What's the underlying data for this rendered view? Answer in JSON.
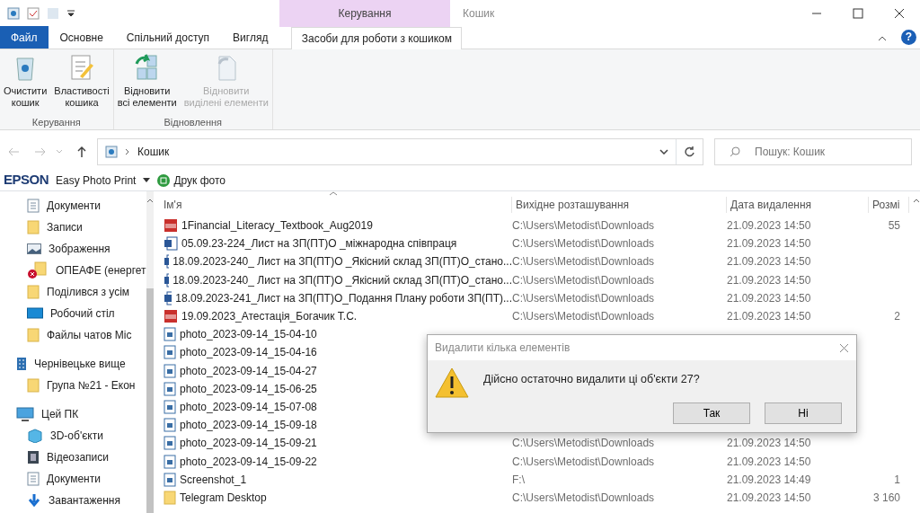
{
  "window": {
    "title": "Кошик",
    "context_group": "Керування",
    "help_glyph": "?"
  },
  "tabs": [
    {
      "label": "Файл",
      "kind": "file",
      "selected": false
    },
    {
      "label": "Основне",
      "kind": "tab",
      "selected": false
    },
    {
      "label": "Спільний доступ",
      "kind": "tab",
      "selected": false
    },
    {
      "label": "Вигляд",
      "kind": "tab",
      "selected": false
    },
    {
      "label": "Засоби для роботи з кошиком",
      "kind": "context",
      "selected": true
    }
  ],
  "ribbon_groups": [
    {
      "label": "Керування",
      "buttons": [
        {
          "label": "Очистити\nкошик",
          "disabled": false
        },
        {
          "label": "Властивості\nкошика",
          "disabled": false
        }
      ]
    },
    {
      "label": "Відновлення",
      "buttons": [
        {
          "label": "Відновити\nвсі елементи",
          "disabled": false
        },
        {
          "label": "Відновити\nвиділені елементи",
          "disabled": true
        }
      ]
    }
  ],
  "address": {
    "path": "Кошик",
    "search_placeholder": "Пошук: Кошик"
  },
  "epson_bar": {
    "brand": "EPSON",
    "app": "Easy Photo Print",
    "action": "Друк фото"
  },
  "sidebar": {
    "sections": [
      {
        "items": [
          {
            "label": "Документи",
            "kind": "doc"
          },
          {
            "label": "Записи",
            "kind": "folder"
          },
          {
            "label": "Зображення",
            "kind": "pictures"
          },
          {
            "label": "ОПЕАФЕ (енергет",
            "kind": "folder_error"
          },
          {
            "label": "Поділився з усім",
            "kind": "folder"
          },
          {
            "label": "Робочий стіл",
            "kind": "desktop"
          },
          {
            "label": "Файлы чатов Mic",
            "kind": "folder"
          }
        ]
      },
      {
        "title": "Чернівецьке вище",
        "kind": "building",
        "items": [
          {
            "label": "Група №21 - Екон",
            "kind": "folder"
          }
        ]
      },
      {
        "title": "Цей ПК",
        "kind": "pc",
        "items": [
          {
            "label": "3D-об'єкти",
            "kind": "cube"
          },
          {
            "label": "Відеозаписи",
            "kind": "video"
          },
          {
            "label": "Документи",
            "kind": "doc"
          },
          {
            "label": "Завантаження",
            "kind": "download"
          }
        ]
      }
    ]
  },
  "table": {
    "columns": [
      "Ім'я",
      "Вихідне розташування",
      "Дата видалення",
      "Розмі"
    ],
    "rows": [
      {
        "kind": "pdf",
        "name": "1Financial_Literacy_Textbook_Aug2019",
        "location": "C:\\Users\\Metodist\\Downloads",
        "date": "21.09.2023 14:50",
        "size": "55"
      },
      {
        "kind": "word",
        "name": "05.09.23-224_Лист на ЗП(ПТ)О _міжнародна співпраця",
        "location": "C:\\Users\\Metodist\\Downloads",
        "date": "21.09.2023 14:50"
      },
      {
        "kind": "word",
        "name": "18.09.2023-240_ Лист на ЗП(ПТ)О _Якісний склад ЗП(ПТ)О_стано...",
        "location": "C:\\Users\\Metodist\\Downloads",
        "date": "21.09.2023 14:50"
      },
      {
        "kind": "word",
        "name": "18.09.2023-240_ Лист на ЗП(ПТ)О _Якісний склад ЗП(ПТ)О_стано...",
        "location": "C:\\Users\\Metodist\\Downloads",
        "date": "21.09.2023 14:50"
      },
      {
        "kind": "word",
        "name": "18.09.2023-241_Лист на ЗП(ПТ)О_Подання Плану роботи ЗП(ПТ)...",
        "location": "C:\\Users\\Metodist\\Downloads",
        "date": "21.09.2023 14:50"
      },
      {
        "kind": "pdf",
        "name": "19.09.2023_Атестація_Богачик Т.С.",
        "location": "C:\\Users\\Metodist\\Downloads",
        "date": "21.09.2023 14:50",
        "size": "2"
      },
      {
        "kind": "image",
        "name": "photo_2023-09-14_15-04-10"
      },
      {
        "kind": "image",
        "name": "photo_2023-09-14_15-04-16"
      },
      {
        "kind": "image",
        "name": "photo_2023-09-14_15-04-27"
      },
      {
        "kind": "image",
        "name": "photo_2023-09-14_15-06-25"
      },
      {
        "kind": "image",
        "name": "photo_2023-09-14_15-07-08"
      },
      {
        "kind": "image",
        "name": "photo_2023-09-14_15-09-18"
      },
      {
        "kind": "image",
        "name": "photo_2023-09-14_15-09-21",
        "location": "C:\\Users\\Metodist\\Downloads",
        "date": "21.09.2023 14:50"
      },
      {
        "kind": "image",
        "name": "photo_2023-09-14_15-09-22",
        "location": "C:\\Users\\Metodist\\Downloads",
        "date": "21.09.2023 14:50"
      },
      {
        "kind": "image",
        "name": "Screenshot_1",
        "location": "F:\\",
        "date": "21.09.2023 14:49",
        "size": "1"
      },
      {
        "kind": "folder",
        "name": "Telegram Desktop",
        "location": "C:\\Users\\Metodist\\Downloads",
        "date": "21.09.2023 14:50",
        "size": "3 160"
      }
    ]
  },
  "dialog": {
    "title": "Видалити кілька елементів",
    "message": "Дійсно остаточно видалити ці об'єкти 27?",
    "buttons": [
      "Так",
      "Ні"
    ]
  }
}
